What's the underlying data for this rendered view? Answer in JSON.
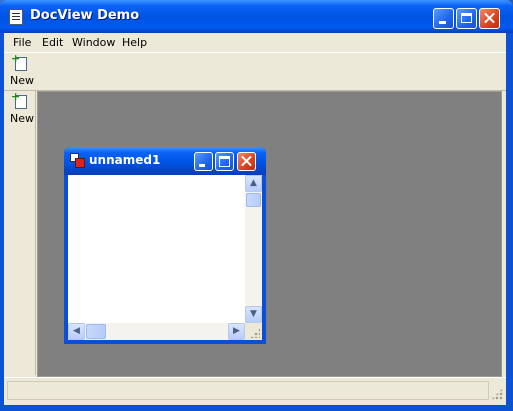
{
  "window": {
    "title": "DocView Demo",
    "controls": {
      "minimize": "minimize",
      "maximize": "maximize",
      "close": "close"
    }
  },
  "menu": {
    "items": [
      {
        "label": "File"
      },
      {
        "label": "Edit"
      },
      {
        "label": "Window"
      },
      {
        "label": "Help"
      }
    ]
  },
  "toolbar": {
    "new_label": "New",
    "new_icon": "new-document-icon"
  },
  "vtoolbar": {
    "new_label": "New",
    "new_icon": "new-document-icon"
  },
  "child": {
    "title": "unnamed1",
    "icon": "document-window-icon",
    "content": ""
  },
  "colors": {
    "titlebar": "#0054e3",
    "mdi_background": "#808080",
    "chrome": "#ece9d8",
    "close_button": "#d8431f"
  }
}
